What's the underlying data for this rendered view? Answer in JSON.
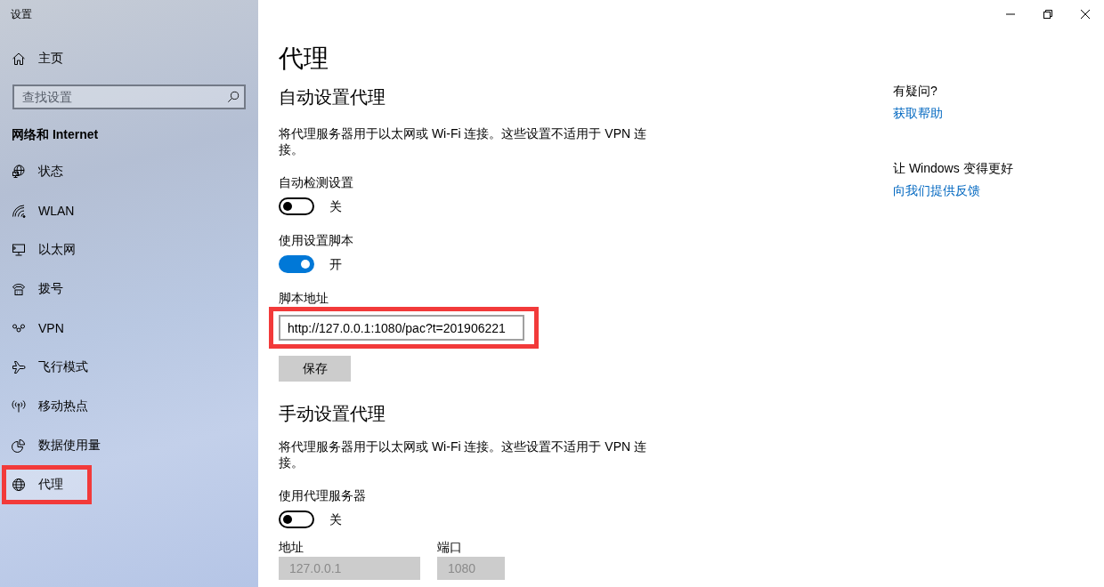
{
  "window": {
    "title": "设置",
    "controls": [
      {
        "kind": "minimize"
      },
      {
        "kind": "restore"
      },
      {
        "kind": "close"
      }
    ]
  },
  "sidebar": {
    "home": {
      "label": "主页"
    },
    "search": {
      "placeholder": "查找设置"
    },
    "section_title": "网络和 Internet",
    "items": [
      {
        "kind": "status",
        "label": "状态",
        "selected": false,
        "highlighted": false
      },
      {
        "kind": "wlan",
        "label": "WLAN",
        "selected": false,
        "highlighted": false
      },
      {
        "kind": "ethernet",
        "label": "以太网",
        "selected": false,
        "highlighted": false
      },
      {
        "kind": "dialup",
        "label": "拨号",
        "selected": false,
        "highlighted": false
      },
      {
        "kind": "vpn",
        "label": "VPN",
        "selected": false,
        "highlighted": false
      },
      {
        "kind": "airplane",
        "label": "飞行模式",
        "selected": false,
        "highlighted": false
      },
      {
        "kind": "hotspot",
        "label": "移动热点",
        "selected": false,
        "highlighted": false
      },
      {
        "kind": "datausage",
        "label": "数据使用量",
        "selected": false,
        "highlighted": false
      },
      {
        "kind": "proxy",
        "label": "代理",
        "selected": true,
        "highlighted": true
      }
    ]
  },
  "main": {
    "title": "代理",
    "sections": [
      {
        "heading": "自动设置代理",
        "description": "将代理服务器用于以太网或 Wi-Fi 连接。这些设置不适用于 VPN 连接。",
        "settings": [
          {
            "kind": "toggle",
            "label": "自动检测设置",
            "on": false,
            "state_text": "关"
          },
          {
            "kind": "toggle",
            "label": "使用设置脚本",
            "on": true,
            "state_text": "开"
          },
          {
            "kind": "text_field",
            "label": "脚本地址",
            "value": "http://127.0.0.1:1080/pac?t=201906221",
            "highlighted": true
          },
          {
            "kind": "button",
            "label": "保存"
          }
        ]
      },
      {
        "heading": "手动设置代理",
        "description": "将代理服务器用于以太网或 Wi-Fi 连接。这些设置不适用于 VPN 连接。",
        "settings": [
          {
            "kind": "toggle",
            "label": "使用代理服务器",
            "on": false,
            "state_text": "关"
          },
          {
            "kind": "field_pair",
            "fields": [
              {
                "label": "地址",
                "value": "127.0.0.1",
                "disabled": true
              },
              {
                "label": "端口",
                "value": "1080",
                "disabled": true
              }
            ]
          }
        ]
      }
    ]
  },
  "help": [
    {
      "heading": "有疑问?",
      "link": "获取帮助"
    },
    {
      "heading": "让 Windows 变得更好",
      "link": "向我们提供反馈"
    }
  ]
}
